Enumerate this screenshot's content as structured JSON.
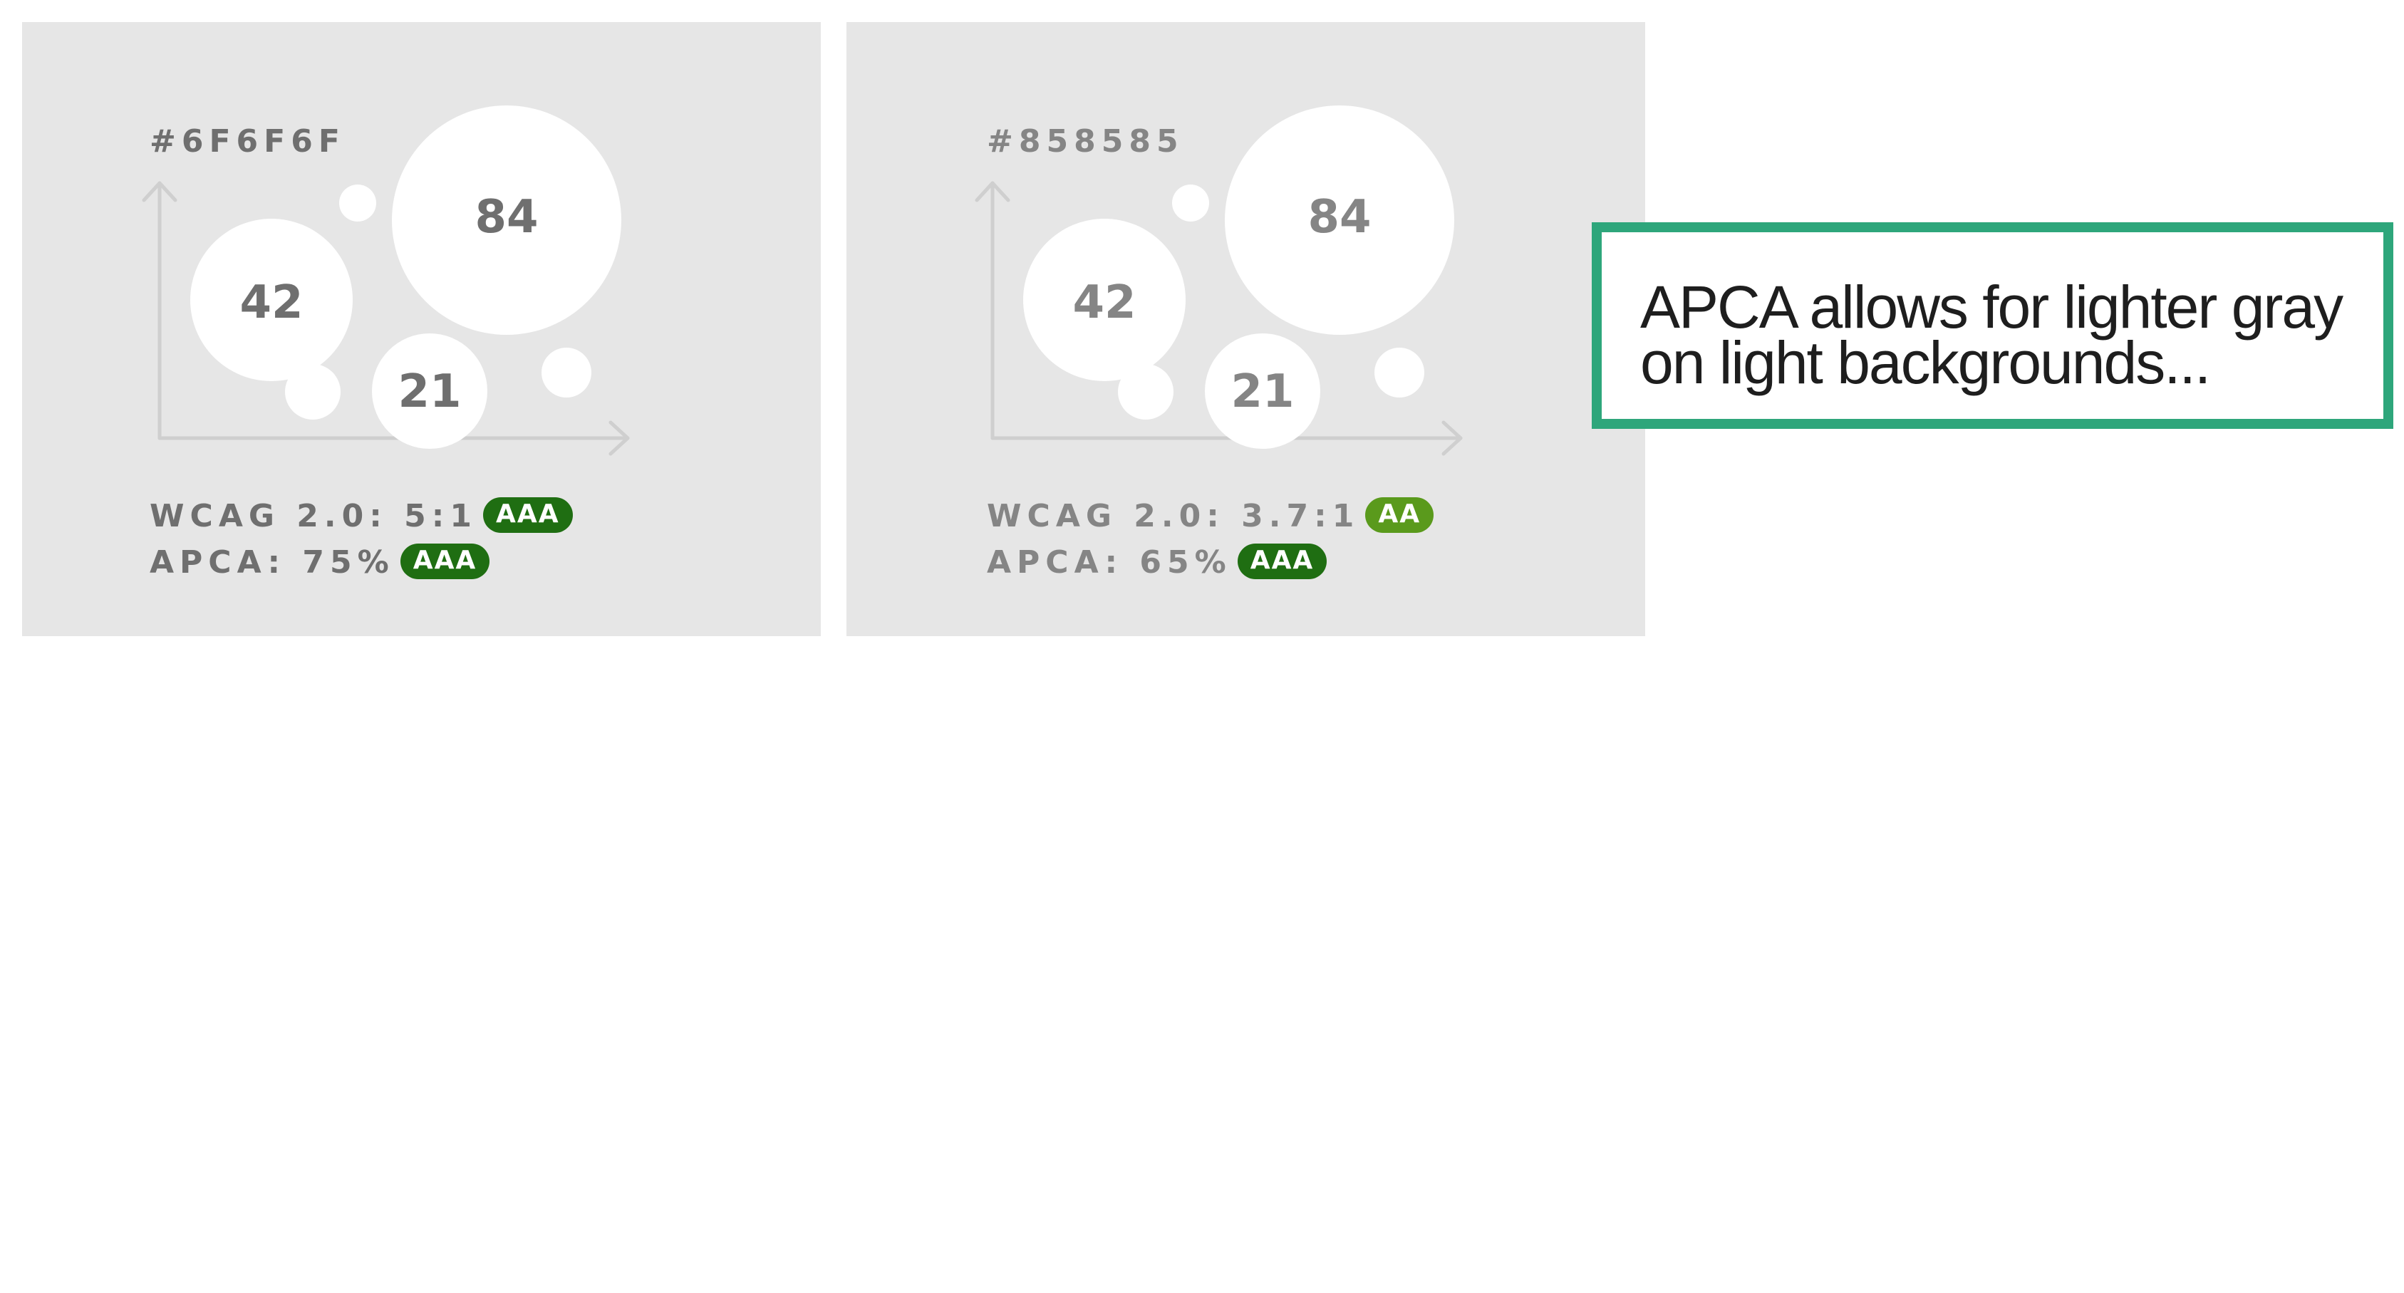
{
  "colors": {
    "card_background": "#e6e6e6",
    "bubble_fill": "#ffffff",
    "axis_stroke": "#cfcfcf",
    "badge_aaa": "#1f6e12",
    "badge_aa": "#5a9a1c",
    "callout_border": "#2ea67b",
    "callout_text": "#1e1e1e"
  },
  "cards": [
    {
      "hex_label": "#6F6F6F",
      "text_color": "#6F6F6F",
      "bubbles": {
        "large": "84",
        "medium": "42",
        "small": "21"
      },
      "wcag_label": "WCAG 2.0: 5:1",
      "wcag_badge": "AAA",
      "wcag_badge_color": "#1f6e12",
      "apca_label": "APCA: 75%",
      "apca_badge": "AAA",
      "apca_badge_color": "#1f6e12"
    },
    {
      "hex_label": "#858585",
      "text_color": "#858585",
      "bubbles": {
        "large": "84",
        "medium": "42",
        "small": "21"
      },
      "wcag_label": "WCAG 2.0: 3.7:1",
      "wcag_badge": "AA",
      "wcag_badge_color": "#5a9a1c",
      "apca_label": "APCA: 65%",
      "apca_badge": "AAA",
      "apca_badge_color": "#1f6e12"
    }
  ],
  "callout": {
    "text": "APCA allows for lighter gray on light backgrounds..."
  }
}
